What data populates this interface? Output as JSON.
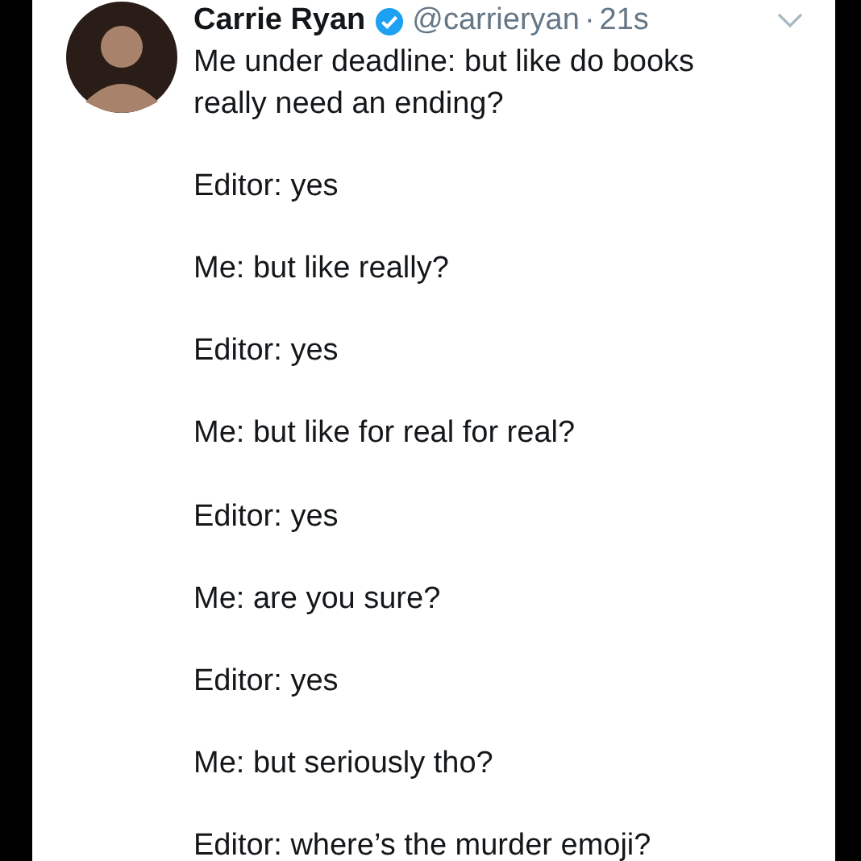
{
  "author": {
    "name": "Carrie Ryan",
    "verified": true,
    "handle": "@carrieryan",
    "separator": "·",
    "time": "21s"
  },
  "tweet": {
    "paragraphs": [
      "Me under deadline: but like do books really need an ending?",
      "Editor: yes",
      "Me: but like really?",
      "Editor: yes",
      "Me: but like for real for real?",
      "Editor: yes",
      "Me: are you sure?",
      "Editor: yes",
      "Me: but seriously tho?",
      "Editor: where’s the murder emoji?"
    ]
  }
}
